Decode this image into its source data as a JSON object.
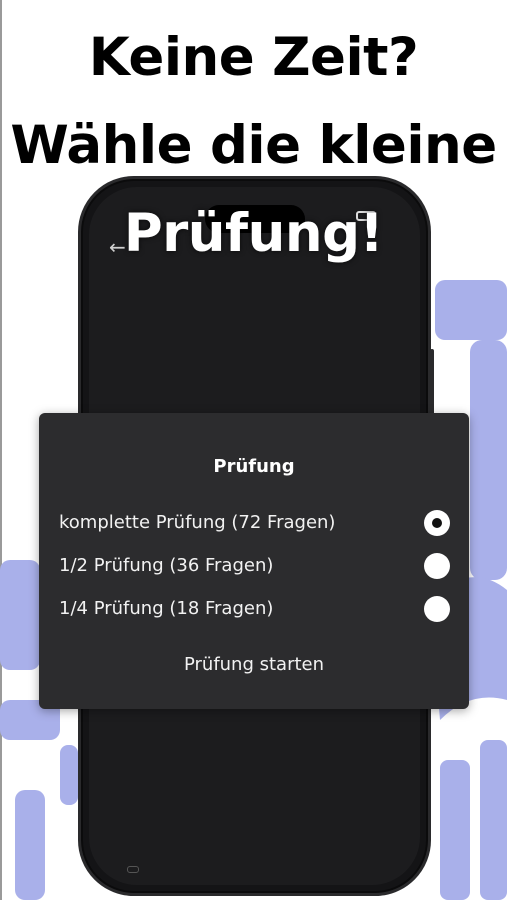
{
  "headline": {
    "line1": "Keine Zeit?",
    "line2": "Wähle die kleine",
    "line3": "Prüfung!"
  },
  "dialog": {
    "title": "Prüfung",
    "options": [
      {
        "label": "komplette Prüfung (72 Fragen)",
        "selected": true
      },
      {
        "label": "1/2 Prüfung (36 Fragen)",
        "selected": false
      },
      {
        "label": "1/4 Prüfung (18 Fragen)",
        "selected": false
      }
    ],
    "start_label": "Prüfung starten"
  },
  "colors": {
    "background": "#ffffff",
    "deco_blue": "#a9b0ea",
    "phone_body": "#141416",
    "dialog_bg": "#2c2c2e",
    "text_on_dark": "#ffffff"
  },
  "icons": {
    "back": "back-arrow-icon",
    "radio_selected": "radio-selected-icon",
    "radio_unselected": "radio-unselected-icon"
  }
}
